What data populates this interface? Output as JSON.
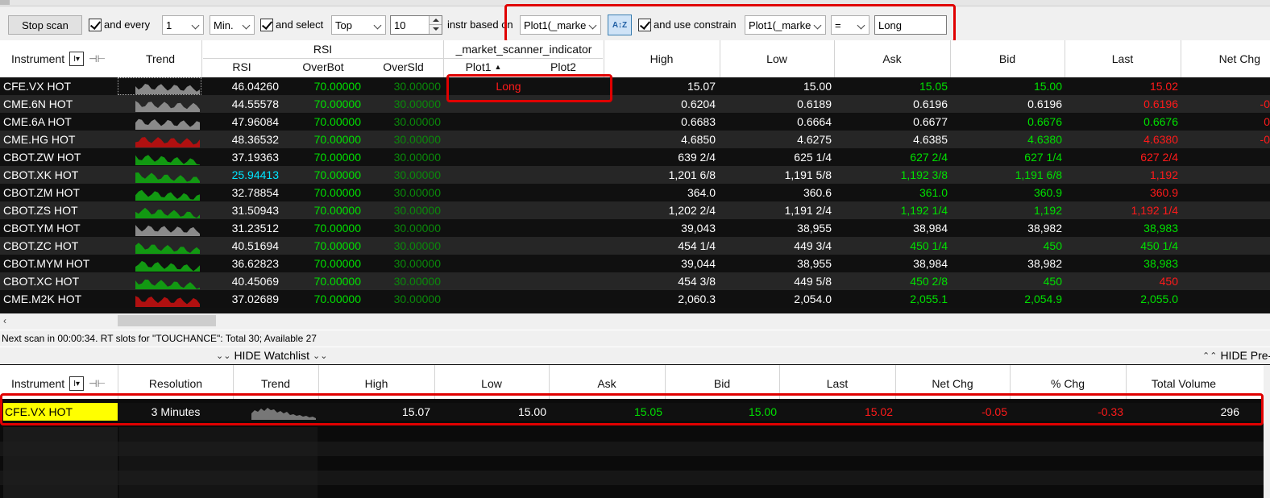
{
  "toolbar": {
    "stop_scan": "Stop scan",
    "and_every": "and every",
    "every_value": "1",
    "unit": "Min.",
    "and_select": "and select",
    "select_mode": "Top",
    "count": "10",
    "instr_based_on": "instr based on",
    "based_on_value": "Plot1(_marke",
    "and_use_constrain": "and use constrain",
    "constrain_plot": "Plot1(_marke",
    "operator": "=",
    "constrain_value": "Long"
  },
  "scanner": {
    "headers": {
      "instrument": "Instrument",
      "trend": "Trend",
      "rsi_group": "RSI",
      "rsi": "RSI",
      "overbot": "OverBot",
      "oversld": "OverSld",
      "indicator_group": "_market_scanner_indicator",
      "plot1": "Plot1",
      "plot2": "Plot2",
      "high": "High",
      "low": "Low",
      "ask": "Ask",
      "bid": "Bid",
      "last": "Last",
      "netchg": "Net Chg"
    },
    "rows": [
      {
        "instrument": "CFE.VX HOT",
        "rsi": "46.04260",
        "overbot": "70.00000",
        "oversld": "30.00000",
        "plot1": "Long",
        "high": "15.07",
        "low": "15.00",
        "ask": "15.05",
        "bid": "15.00",
        "last": "15.02",
        "netchg": "",
        "trend": "grey"
      },
      {
        "instrument": "CME.6N HOT",
        "rsi": "44.55578",
        "overbot": "70.00000",
        "oversld": "30.00000",
        "plot1": "",
        "high": "0.6204",
        "low": "0.6189",
        "ask": "0.6196",
        "bid": "0.6196",
        "last": "0.6196",
        "netchg": "-0",
        "trend": "grey"
      },
      {
        "instrument": "CME.6A HOT",
        "rsi": "47.96084",
        "overbot": "70.00000",
        "oversld": "30.00000",
        "plot1": "",
        "high": "0.6683",
        "low": "0.6664",
        "ask": "0.6677",
        "bid": "0.6676",
        "last": "0.6676",
        "netchg": "0",
        "trend": "grey"
      },
      {
        "instrument": "CME.HG HOT",
        "rsi": "48.36532",
        "overbot": "70.00000",
        "oversld": "30.00000",
        "plot1": "",
        "high": "4.6850",
        "low": "4.6275",
        "ask": "4.6385",
        "bid": "4.6380",
        "last": "4.6380",
        "netchg": "-0",
        "trend": "red"
      },
      {
        "instrument": "CBOT.ZW HOT",
        "rsi": "37.19363",
        "overbot": "70.00000",
        "oversld": "30.00000",
        "plot1": "",
        "high": "639 2/4",
        "low": "625 1/4",
        "ask": "627 2/4",
        "bid": "627 1/4",
        "last": "627 2/4",
        "netchg": "",
        "trend": "green"
      },
      {
        "instrument": "CBOT.XK HOT",
        "rsi": "25.94413",
        "overbot": "70.00000",
        "oversld": "30.00000",
        "plot1": "",
        "high": "1,201 6/8",
        "low": "1,191 5/8",
        "ask": "1,192 3/8",
        "bid": "1,191 6/8",
        "last": "1,192",
        "netchg": "",
        "trend": "green"
      },
      {
        "instrument": "CBOT.ZM HOT",
        "rsi": "32.78854",
        "overbot": "70.00000",
        "oversld": "30.00000",
        "plot1": "",
        "high": "364.0",
        "low": "360.6",
        "ask": "361.0",
        "bid": "360.9",
        "last": "360.9",
        "netchg": "",
        "trend": "green"
      },
      {
        "instrument": "CBOT.ZS HOT",
        "rsi": "31.50943",
        "overbot": "70.00000",
        "oversld": "30.00000",
        "plot1": "",
        "high": "1,202 2/4",
        "low": "1,191 2/4",
        "ask": "1,192 1/4",
        "bid": "1,192",
        "last": "1,192 1/4",
        "netchg": "",
        "trend": "green"
      },
      {
        "instrument": "CBOT.YM HOT",
        "rsi": "31.23512",
        "overbot": "70.00000",
        "oversld": "30.00000",
        "plot1": "",
        "high": "39,043",
        "low": "38,955",
        "ask": "38,984",
        "bid": "38,982",
        "last": "38,983",
        "netchg": "",
        "trend": "grey"
      },
      {
        "instrument": "CBOT.ZC HOT",
        "rsi": "40.51694",
        "overbot": "70.00000",
        "oversld": "30.00000",
        "plot1": "",
        "high": "454 1/4",
        "low": "449 3/4",
        "ask": "450 1/4",
        "bid": "450",
        "last": "450 1/4",
        "netchg": "",
        "trend": "green"
      },
      {
        "instrument": "CBOT.MYM HOT",
        "rsi": "36.62823",
        "overbot": "70.00000",
        "oversld": "30.00000",
        "plot1": "",
        "high": "39,044",
        "low": "38,955",
        "ask": "38,984",
        "bid": "38,982",
        "last": "38,983",
        "netchg": "",
        "trend": "green"
      },
      {
        "instrument": "CBOT.XC HOT",
        "rsi": "40.45069",
        "overbot": "70.00000",
        "oversld": "30.00000",
        "plot1": "",
        "high": "454 3/8",
        "low": "449 5/8",
        "ask": "450 2/8",
        "bid": "450",
        "last": "450",
        "netchg": "",
        "trend": "green"
      },
      {
        "instrument": "CME.M2K HOT",
        "rsi": "37.02689",
        "overbot": "70.00000",
        "oversld": "30.00000",
        "plot1": "",
        "high": "2,060.3",
        "low": "2,054.0",
        "ask": "2,055.1",
        "bid": "2,054.9",
        "last": "2,055.0",
        "netchg": "",
        "trend": "red"
      }
    ]
  },
  "status": "Next scan in 00:00:34. RT slots for \"TOUCHANCE\": Total 30; Available 27",
  "divider": {
    "hide_watchlist": "HIDE Watchlist",
    "hide_pre": "HIDE Pre-"
  },
  "watchlist": {
    "headers": {
      "instrument": "Instrument",
      "resolution": "Resolution",
      "trend": "Trend",
      "high": "High",
      "low": "Low",
      "ask": "Ask",
      "bid": "Bid",
      "last": "Last",
      "netchg": "Net Chg",
      "pctchg": "% Chg",
      "volume": "Total Volume"
    },
    "row": {
      "instrument": "CFE.VX HOT",
      "resolution": "3 Minutes",
      "high": "15.07",
      "low": "15.00",
      "ask": "15.05",
      "bid": "15.00",
      "last": "15.02",
      "netchg": "-0.05",
      "pctchg": "-0.33",
      "volume": "296"
    }
  },
  "colors": {
    "up": "#00e000",
    "down": "#ff1a1a",
    "highlight": "#ffff00",
    "box": "#e00000",
    "low_rsi": "#00e5ff"
  }
}
